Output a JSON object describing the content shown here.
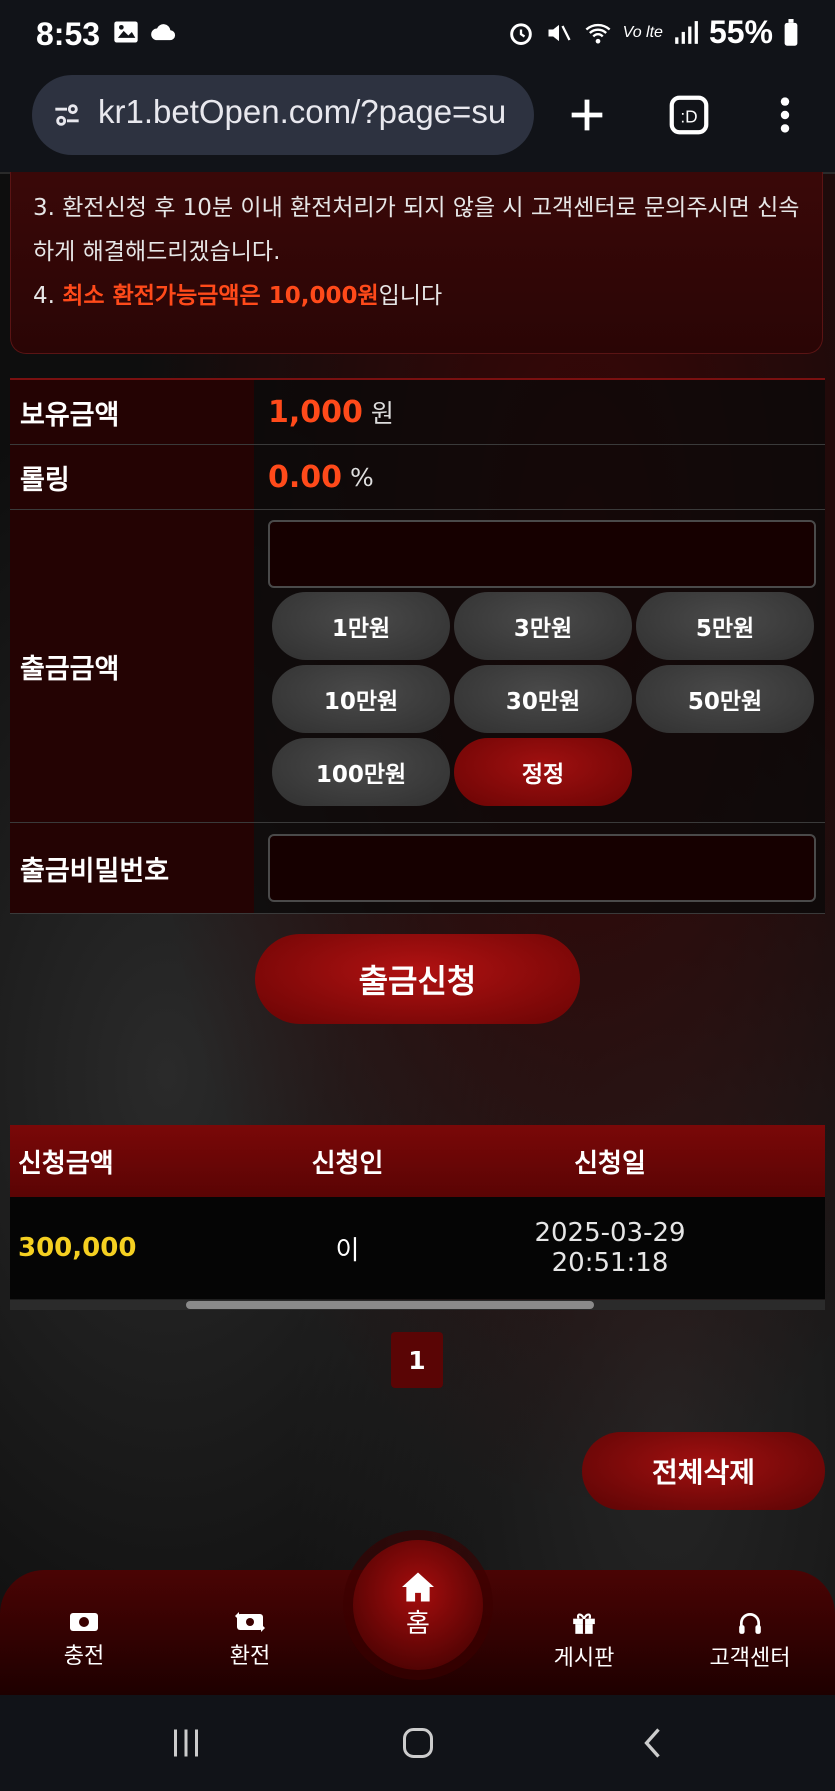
{
  "status_bar": {
    "time": "8:53",
    "battery": "55%"
  },
  "browser": {
    "url": "kr1.betOpen.com/?page=su"
  },
  "notice": {
    "line3": "3. 환전신청 후 10분 이내 환전처리가 되지 않을 시 고객센터로 문의주시면 신속하게 해결해드리겠습니다.",
    "line4_prefix": "4. ",
    "line4_highlight": "최소 환전가능금액은 10,000원",
    "line4_suffix": "입니다"
  },
  "form": {
    "balance": {
      "label": "보유금액",
      "value": "1,000",
      "unit": "원"
    },
    "rolling": {
      "label": "롤링",
      "value": "0.00",
      "unit": "%"
    },
    "amount": {
      "label": "출금금액",
      "input_value": "",
      "chips": [
        "1만원",
        "3만원",
        "5만원",
        "10만원",
        "30만원",
        "50만원",
        "100만원"
      ],
      "reset": "정정"
    },
    "password": {
      "label": "출금비밀번호",
      "input_value": ""
    },
    "submit": "출금신청"
  },
  "history": {
    "columns": [
      "신청금액",
      "신청인",
      "신청일"
    ],
    "rows": [
      {
        "amount": "300,000",
        "applicant": "이",
        "date": "2025-03-29 20:51:18"
      }
    ]
  },
  "pagination": {
    "current": "1"
  },
  "delete_all": "전체삭제",
  "bottom_nav": {
    "deposit": "충전",
    "exchange": "환전",
    "home": "홈",
    "board": "게시판",
    "support": "고객센터"
  },
  "colors": {
    "accent_red": "#ff4a1a",
    "amount_yellow": "#f5d021",
    "brand_dark_red": "#5a0505"
  }
}
